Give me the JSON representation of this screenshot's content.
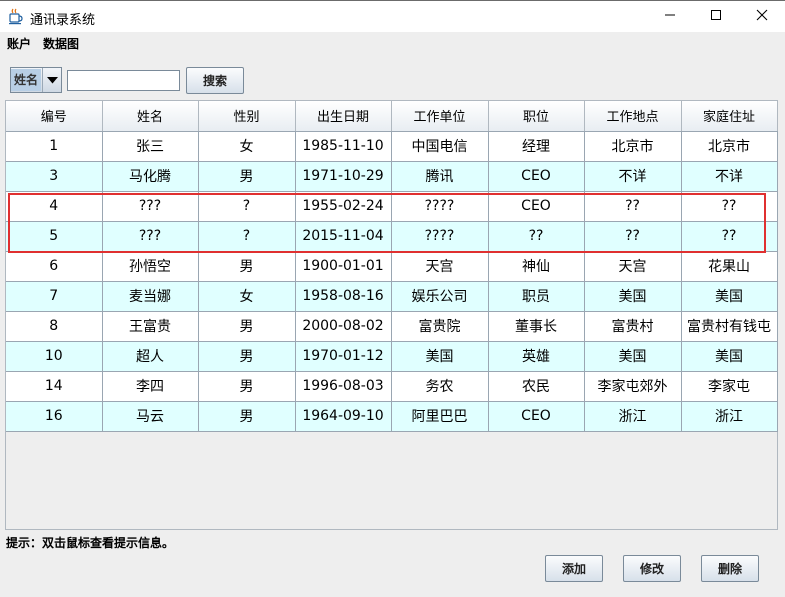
{
  "window": {
    "title": "通讯录系统",
    "app_icon": "java-cup-icon",
    "controls": [
      "minimize-icon",
      "maximize-icon",
      "close-icon"
    ]
  },
  "menu": [
    "账户",
    "数据图"
  ],
  "search": {
    "field_selected": "姓名",
    "query_value": "",
    "button_label": "搜索"
  },
  "table": {
    "headers": [
      "编号",
      "姓名",
      "性别",
      "出生日期",
      "工作单位",
      "职位",
      "工作地点",
      "家庭住址"
    ],
    "rows": [
      [
        "1",
        "张三",
        "女",
        "1985-11-10",
        "中国电信",
        "经理",
        "北京市",
        "北京市"
      ],
      [
        "3",
        "马化腾",
        "男",
        "1971-10-29",
        "腾讯",
        "CEO",
        "不详",
        "不详"
      ],
      [
        "4",
        "???",
        "?",
        "1955-02-24",
        "????",
        "CEO",
        "??",
        "??"
      ],
      [
        "5",
        "???",
        "?",
        "2015-11-04",
        "????",
        "??",
        "??",
        "??"
      ],
      [
        "6",
        "孙悟空",
        "男",
        "1900-01-01",
        "天宫",
        "神仙",
        "天宫",
        "花果山"
      ],
      [
        "7",
        "麦当娜",
        "女",
        "1958-08-16",
        "娱乐公司",
        "职员",
        "美国",
        "美国"
      ],
      [
        "8",
        "王富贵",
        "男",
        "2000-08-02",
        "富贵院",
        "董事长",
        "富贵村",
        "富贵村有钱屯"
      ],
      [
        "10",
        "超人",
        "男",
        "1970-01-12",
        "美国",
        "英雄",
        "美国",
        "美国"
      ],
      [
        "14",
        "李四",
        "男",
        "1996-08-03",
        "务农",
        "农民",
        "李家屯郊外",
        "李家屯"
      ],
      [
        "16",
        "马云",
        "男",
        "1964-09-10",
        "阿里巴巴",
        "CEO",
        "浙江",
        "浙江"
      ]
    ]
  },
  "hint": "提示：双击鼠标查看提示信息。",
  "actions": {
    "add_label": "添加",
    "edit_label": "修改",
    "delete_label": "删除"
  },
  "colors": {
    "row_alt": "#e0ffff",
    "highlight": "#e03030"
  }
}
